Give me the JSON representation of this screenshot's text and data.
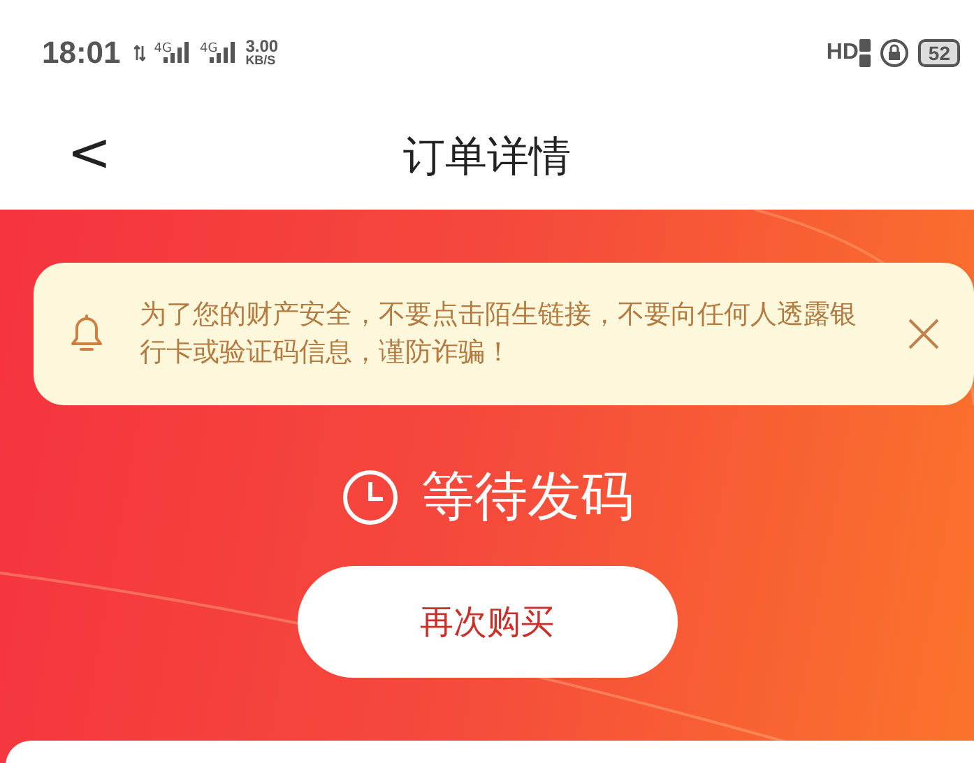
{
  "status_bar": {
    "time": "18:01",
    "networks": [
      {
        "label": "4G"
      },
      {
        "label": "4G"
      }
    ],
    "speed": "3.00",
    "speed_unit": "KB/S",
    "hd_label": "HD",
    "battery": "52"
  },
  "header": {
    "back": "<",
    "title": "订单详情"
  },
  "notice": {
    "text": "为了您的财产安全，不要点击陌生链接，不要向任何人透露银行卡或验证码信息，谨防诈骗！"
  },
  "order_status": {
    "label": "等待发码"
  },
  "buttons": [
    {
      "label": "再次购买"
    }
  ]
}
